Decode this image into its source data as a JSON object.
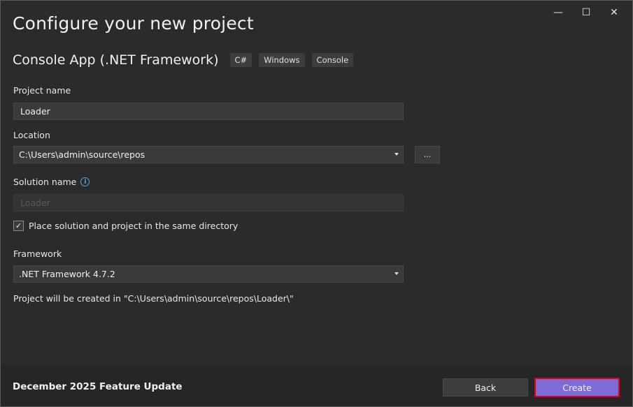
{
  "window": {
    "controls": {
      "minimize": "—",
      "maximize": "☐",
      "close": "✕"
    }
  },
  "header": {
    "title": "Configure your new project",
    "template_name": "Console App (.NET Framework)",
    "tags": [
      "C#",
      "Windows",
      "Console"
    ]
  },
  "form": {
    "project_name": {
      "label": "Project name",
      "value": "Loader"
    },
    "location": {
      "label": "Location",
      "value": "C:\\Users\\admin\\source\\repos",
      "browse_label": "..."
    },
    "solution_name": {
      "label": "Solution name",
      "placeholder": "Loader"
    },
    "same_directory": {
      "label": "Place solution and project in the same directory",
      "checked": true
    },
    "framework": {
      "label": "Framework",
      "value": ".NET Framework 4.7.2"
    },
    "path_info": "Project will be created in \"C:\\Users\\admin\\source\\repos\\Loader\\\""
  },
  "footer": {
    "feature_update": "December 2025 Feature Update",
    "back_label": "Back",
    "create_label": "Create"
  },
  "colors": {
    "accent": "#7f6bd6",
    "highlight_border": "#e0001a",
    "info_icon": "#5aa3e8"
  }
}
